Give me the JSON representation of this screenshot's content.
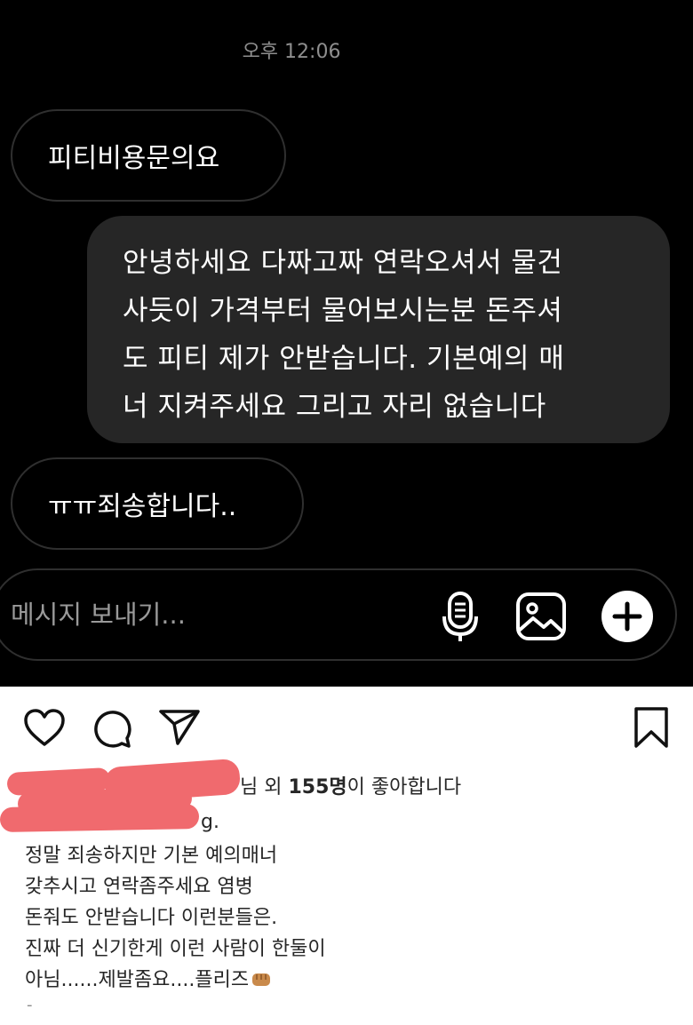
{
  "dm": {
    "timestamp": "오후 12:06",
    "messages": [
      {
        "direction": "received",
        "text": "피티비용문의요"
      },
      {
        "direction": "sent",
        "lines": [
          "안녕하세요 다짜고짜 연락오셔서 물건",
          "사듯이 가격부터 물어보시는분 돈주셔",
          "도 피티 제가 안받습니다. 기본예의 매",
          "너 지켜주세요 그리고 자리 없습니다"
        ]
      },
      {
        "direction": "received",
        "text": "ㅠㅠ죄송합니다.."
      }
    ],
    "composer": {
      "placeholder": "메시지 보내기...",
      "icons": [
        "microphone-icon",
        "image-icon",
        "plus-icon"
      ]
    }
  },
  "post": {
    "action_icons": [
      "heart-icon",
      "comment-icon",
      "share-icon",
      "bookmark-icon"
    ],
    "likes": {
      "prefix": "님 외 ",
      "count": "155명",
      "suffix": "이 좋아합니다"
    },
    "caption_username_tail": "g.",
    "caption_lines": [
      "정말 죄송하지만 기본 예의매너",
      "갖추시고 연락좀주세요 염병",
      "돈줘도 안받습니다 이런분들은.",
      "진짜 더 신기한게 이런 사람이 한둘이",
      "아님......제발좀요....플리즈"
    ],
    "caption_emoji": "fist-icon",
    "trailing": "-"
  },
  "colors": {
    "dm_background": "#000000",
    "sent_bubble": "#262626",
    "received_border": "#2f2f2f",
    "redaction": "#f06a6e"
  }
}
